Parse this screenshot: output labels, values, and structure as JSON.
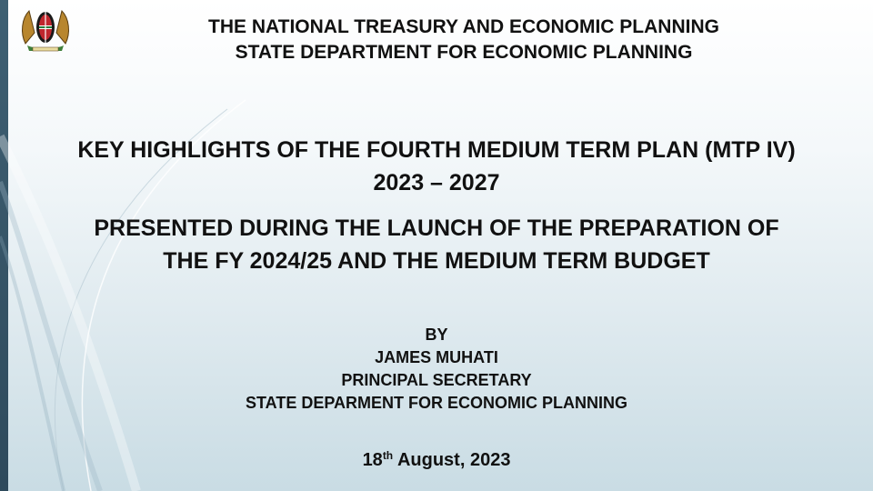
{
  "header": {
    "line1": "THE NATIONAL TREASURY AND ECONOMIC PLANNING",
    "line2": "STATE DEPARTMENT FOR ECONOMIC PLANNING"
  },
  "title": {
    "line1": "KEY HIGHLIGHTS OF THE FOURTH MEDIUM TERM PLAN  (MTP IV)",
    "line2": "2023 – 2027"
  },
  "subtitle": {
    "line1": "PRESENTED DURING THE LAUNCH OF THE PREPARATION OF",
    "line2": "THE FY 2024/25 AND THE MEDIUM TERM BUDGET"
  },
  "presenter": {
    "by": "BY",
    "name": "JAMES MUHATI",
    "role": "PRINCIPAL SECRETARY",
    "department": "STATE DEPARMENT FOR ECONOMIC PLANNING"
  },
  "date": {
    "day": "18",
    "suffix": "th",
    "rest": " August, 2023"
  },
  "icons": {
    "crest": "kenya-coat-of-arms-icon"
  },
  "colors": {
    "left_bar": "#2e4a5c",
    "text": "#111111"
  }
}
